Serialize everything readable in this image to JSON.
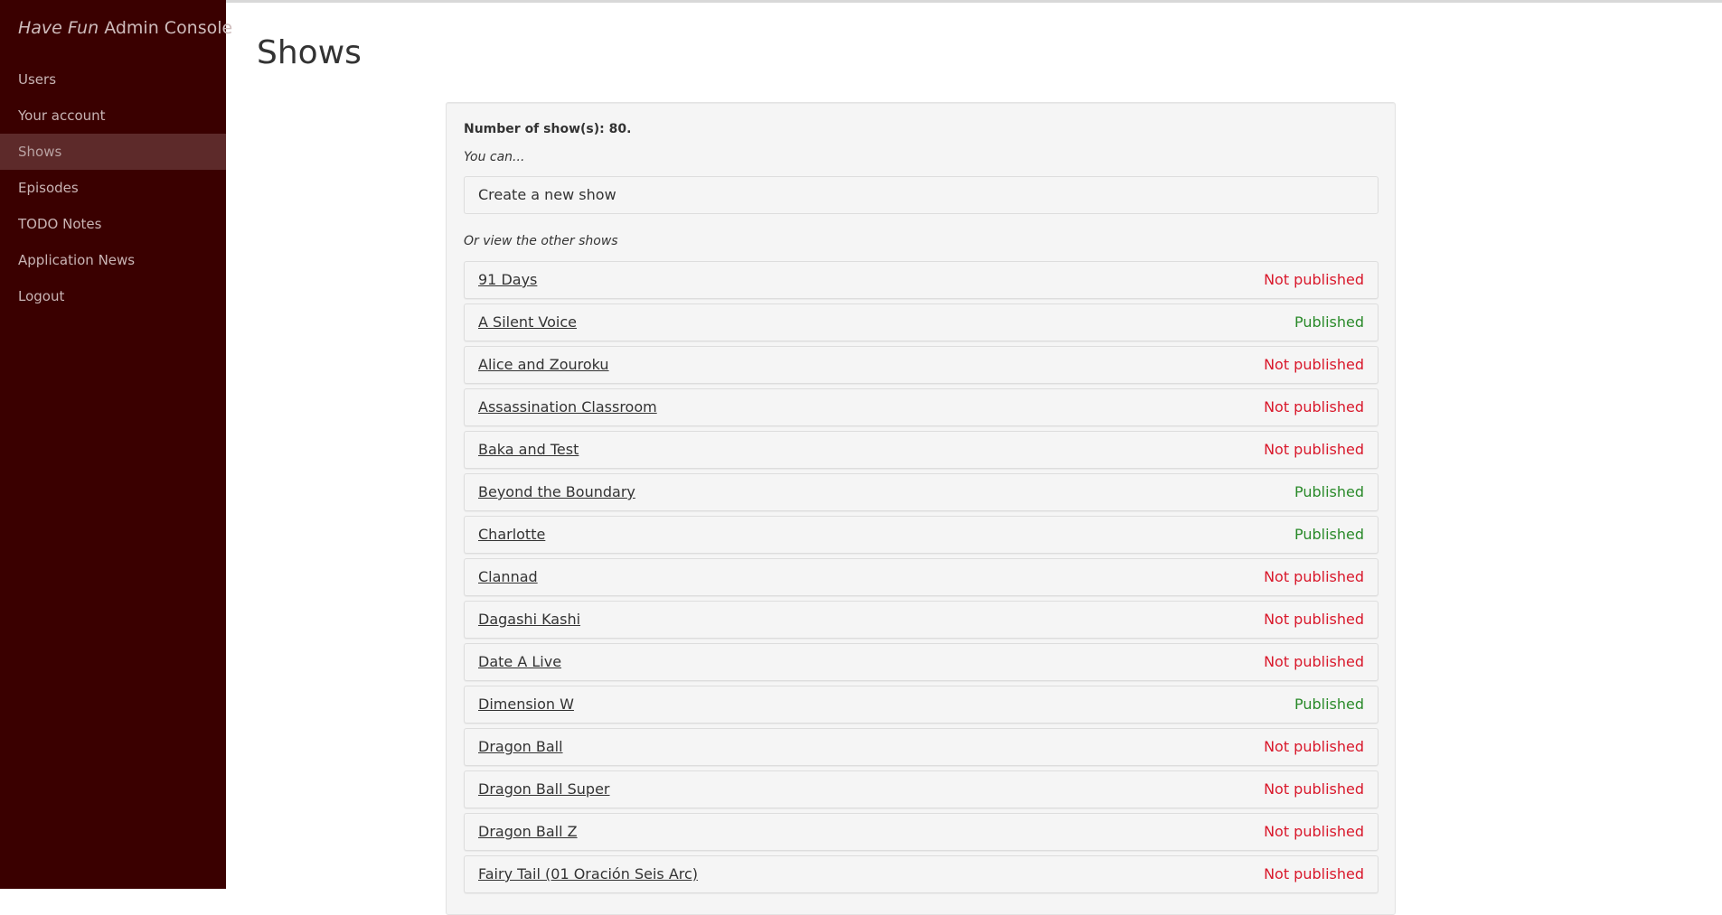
{
  "sidebar": {
    "brand_italic": "Have Fun",
    "brand_rest": "Admin Console",
    "items": [
      {
        "label": "Users",
        "active": false
      },
      {
        "label": "Your account",
        "active": false
      },
      {
        "label": "Shows",
        "active": true
      },
      {
        "label": "Episodes",
        "active": false
      },
      {
        "label": "TODO Notes",
        "active": false
      },
      {
        "label": "Application News",
        "active": false
      },
      {
        "label": "Logout",
        "active": false
      }
    ]
  },
  "main": {
    "title": "Shows",
    "count_text": "Number of show(s): 80.",
    "you_can": "You can...",
    "create_label": "Create a new show",
    "or_view": "Or view the other shows"
  },
  "colors": {
    "sidebar_bg": "#3a0000",
    "published": "#2a8a2a",
    "not_published": "#d9182b"
  },
  "shows": [
    {
      "name": "91 Days",
      "status": "Not published"
    },
    {
      "name": "A Silent Voice",
      "status": "Published"
    },
    {
      "name": "Alice and Zouroku",
      "status": "Not published"
    },
    {
      "name": "Assassination Classroom",
      "status": "Not published"
    },
    {
      "name": "Baka and Test",
      "status": "Not published"
    },
    {
      "name": "Beyond the Boundary",
      "status": "Published"
    },
    {
      "name": "Charlotte",
      "status": "Published"
    },
    {
      "name": "Clannad",
      "status": "Not published"
    },
    {
      "name": "Dagashi Kashi",
      "status": "Not published"
    },
    {
      "name": "Date A Live",
      "status": "Not published"
    },
    {
      "name": "Dimension W",
      "status": "Published"
    },
    {
      "name": "Dragon Ball",
      "status": "Not published"
    },
    {
      "name": "Dragon Ball Super",
      "status": "Not published"
    },
    {
      "name": "Dragon Ball Z",
      "status": "Not published"
    },
    {
      "name": "Fairy Tail (01 Oración Seis Arc)",
      "status": "Not published"
    }
  ]
}
